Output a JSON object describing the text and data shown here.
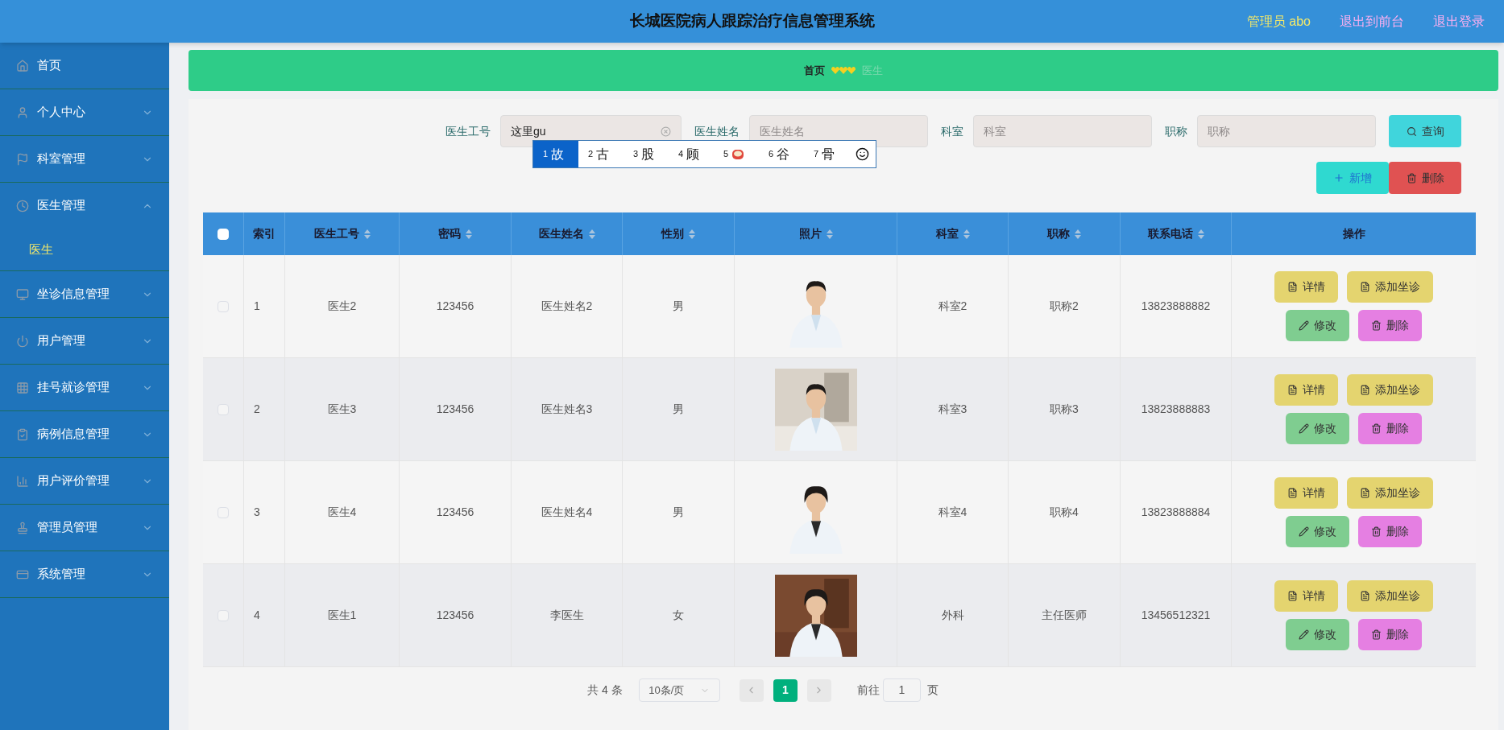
{
  "header": {
    "title": "长城医院病人跟踪治疗信息管理系统",
    "user": "管理员 abo",
    "links": [
      "退出到前台",
      "退出登录"
    ]
  },
  "sidebar": {
    "items": [
      {
        "label": "首页",
        "kind": "link"
      },
      {
        "label": "个人中心",
        "kind": "menu",
        "expanded": false
      },
      {
        "label": "科室管理",
        "kind": "menu",
        "expanded": false
      },
      {
        "label": "医生管理",
        "kind": "menu",
        "expanded": true,
        "children": [
          {
            "label": "医生",
            "selected": true
          }
        ]
      },
      {
        "label": "坐诊信息管理",
        "kind": "menu",
        "expanded": false
      },
      {
        "label": "用户管理",
        "kind": "menu",
        "expanded": false
      },
      {
        "label": "挂号就诊管理",
        "kind": "menu",
        "expanded": false
      },
      {
        "label": "病例信息管理",
        "kind": "menu",
        "expanded": false
      },
      {
        "label": "用户评价管理",
        "kind": "menu",
        "expanded": false
      },
      {
        "label": "管理员管理",
        "kind": "menu",
        "expanded": false
      },
      {
        "label": "系统管理",
        "kind": "menu",
        "expanded": false
      }
    ]
  },
  "breadcrumb": {
    "home": "首页",
    "current": "医生"
  },
  "search": {
    "fields": [
      {
        "label": "医生工号",
        "value": "这里gu"
      },
      {
        "label": "医生姓名",
        "placeholder": "医生姓名"
      },
      {
        "label": "科室",
        "placeholder": "科室"
      },
      {
        "label": "职称",
        "placeholder": "职称"
      }
    ],
    "button": "查询"
  },
  "ime": {
    "candidates": [
      {
        "number": "1",
        "text": "故",
        "kind": "text",
        "selected": true
      },
      {
        "number": "2",
        "text": "古",
        "kind": "text",
        "selected": false
      },
      {
        "number": "3",
        "text": "股",
        "kind": "text",
        "selected": false
      },
      {
        "number": "4",
        "text": "顾",
        "kind": "text",
        "selected": false
      },
      {
        "number": "5",
        "kind": "emoji",
        "selected": false
      },
      {
        "number": "6",
        "text": "谷",
        "kind": "text",
        "selected": false
      },
      {
        "number": "7",
        "text": "骨",
        "kind": "text",
        "selected": false
      }
    ]
  },
  "actions": {
    "add": "新增",
    "delete": "删除"
  },
  "table": {
    "header_checked": false,
    "columns": [
      {
        "label": "索引",
        "sortable": false
      },
      {
        "label": "医生工号",
        "sortable": true
      },
      {
        "label": "密码",
        "sortable": true
      },
      {
        "label": "医生姓名",
        "sortable": true
      },
      {
        "label": "性别",
        "sortable": true
      },
      {
        "label": "照片",
        "sortable": true
      },
      {
        "label": "科室",
        "sortable": true
      },
      {
        "label": "职称",
        "sortable": true
      },
      {
        "label": "联系电话",
        "sortable": true
      },
      {
        "label": "操作",
        "sortable": false
      }
    ],
    "rows": [
      {
        "checked": false,
        "index": "1",
        "id": "医生2",
        "password": "123456",
        "name": "医生姓名2",
        "gender": "男",
        "dept": "科室2",
        "title": "职称2",
        "phone": "13823888882"
      },
      {
        "checked": false,
        "index": "2",
        "id": "医生3",
        "password": "123456",
        "name": "医生姓名3",
        "gender": "男",
        "dept": "科室3",
        "title": "职称3",
        "phone": "13823888883"
      },
      {
        "checked": false,
        "index": "3",
        "id": "医生4",
        "password": "123456",
        "name": "医生姓名4",
        "gender": "男",
        "dept": "科室4",
        "title": "职称4",
        "phone": "13823888884"
      },
      {
        "checked": false,
        "index": "4",
        "id": "医生1",
        "password": "123456",
        "name": "李医生",
        "gender": "女",
        "dept": "外科",
        "title": "主任医师",
        "phone": "13456512321"
      }
    ],
    "row_buttons": [
      [
        {
          "label": "详情",
          "kind": "detail"
        },
        {
          "label": "添加坐诊",
          "kind": "detail"
        },
        {
          "label": "修改",
          "kind": "edit"
        },
        {
          "label": "删除",
          "kind": "remove"
        }
      ],
      [
        {
          "label": "详情",
          "kind": "detail"
        },
        {
          "label": "添加坐诊",
          "kind": "detail"
        },
        {
          "label": "修改",
          "kind": "edit"
        },
        {
          "label": "删除",
          "kind": "remove"
        }
      ],
      [
        {
          "label": "详情",
          "kind": "detail"
        },
        {
          "label": "添加坐诊",
          "kind": "detail"
        },
        {
          "label": "修改",
          "kind": "edit"
        },
        {
          "label": "删除",
          "kind": "remove"
        }
      ],
      [
        {
          "label": "详情",
          "kind": "detail"
        },
        {
          "label": "添加坐诊",
          "kind": "detail"
        },
        {
          "label": "修改",
          "kind": "edit"
        },
        {
          "label": "删除",
          "kind": "remove"
        }
      ]
    ]
  },
  "pagination": {
    "total": "共 4 条",
    "page_size": "10条/页",
    "pages": [
      {
        "label": "1",
        "selected": true
      }
    ],
    "goto": "前往",
    "goto_value": "1",
    "suffix": "页"
  }
}
